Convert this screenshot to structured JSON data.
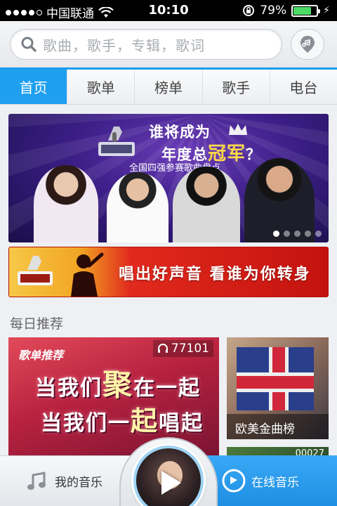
{
  "status_bar": {
    "carrier": "中国联通",
    "time": "10:10",
    "battery_percent": "79%",
    "battery_level": 0.79,
    "signal_bars": 4
  },
  "search": {
    "placeholder": "歌曲，歌手，专辑，歌词"
  },
  "tabs": [
    {
      "label": "首页",
      "active": true
    },
    {
      "label": "歌单",
      "active": false
    },
    {
      "label": "榜单",
      "active": false
    },
    {
      "label": "歌手",
      "active": false
    },
    {
      "label": "电台",
      "active": false
    }
  ],
  "banner": {
    "title_line1": "谁将成为",
    "title_line2_a": "年度总",
    "title_line2_b": "冠军",
    "title_line2_c": "？",
    "subtitle": "全国四强参赛歌曲盘点",
    "page_count": 5,
    "active_page": 1
  },
  "promo": {
    "text": "唱出好声音 看谁为你转身"
  },
  "daily": {
    "title": "每日推荐",
    "big_card": {
      "tag": "歌单推荐",
      "play_count": "77101",
      "line1_a": "当我们",
      "line1_b": "聚",
      "line1_c": "在一起",
      "line2_a": "当我们一",
      "line2_b": "起",
      "line2_c": "唱起"
    },
    "small_card": {
      "label": "欧美金曲榜"
    },
    "small_card2": {
      "count": "00027"
    }
  },
  "bottom_bar": {
    "my_music": "我的音乐",
    "online_music": "在线音乐"
  },
  "colors": {
    "accent": "#1f9ff0",
    "promo_red": "#c4120e"
  }
}
